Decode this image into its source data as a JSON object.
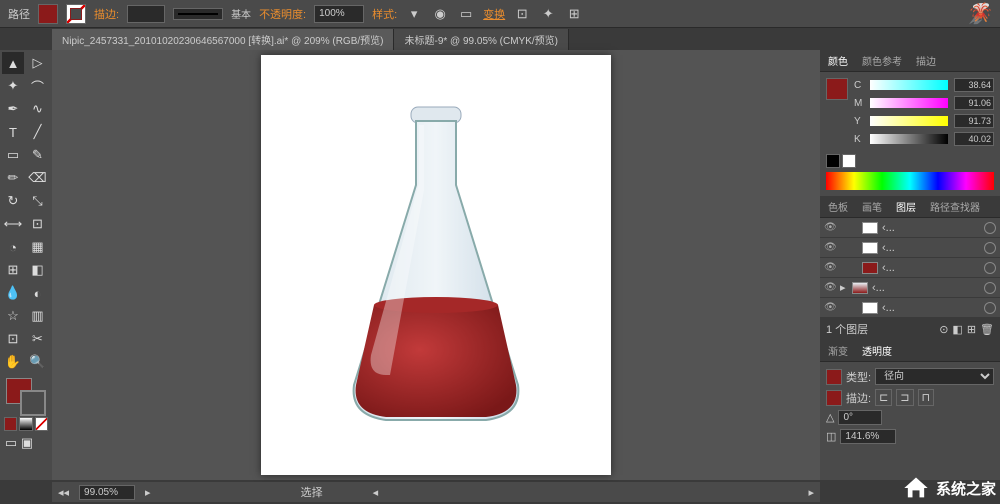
{
  "topbar": {
    "path_label": "路径",
    "stroke_label": "描边:",
    "stroke_value": "",
    "stroke_style_label": "基本",
    "opacity_label": "不透明度:",
    "opacity_value": "100%",
    "style_label": "样式:",
    "transform_label": "变换"
  },
  "tabs": [
    "Nipic_2457331_20101020230646567000 [转换].ai* @ 209% (RGB/预览)",
    "未标题-9* @ 99.05% (CMYK/预览)"
  ],
  "color_panel": {
    "title": "颜色",
    "ref_tab": "颜色参考",
    "stroke_tab": "描边",
    "cmyk": {
      "c": "38.64",
      "m": "91.06",
      "y": "91.73",
      "k": "40.02"
    }
  },
  "layers_panel": {
    "tabs": [
      "色板",
      "画笔",
      "图层",
      "路径查找器"
    ],
    "count_label": "1 个图层",
    "layer_name": "‹..."
  },
  "transparency_panel": {
    "tabs": [
      "渐变",
      "透明度"
    ],
    "type_label": "类型:",
    "type_value": "径向",
    "stroke_label": "描边:",
    "angle_value": "0°",
    "zoom_value": "141.6%"
  },
  "status": {
    "zoom": "99.05%",
    "select_label": "选择"
  },
  "watermark": "系统之家"
}
